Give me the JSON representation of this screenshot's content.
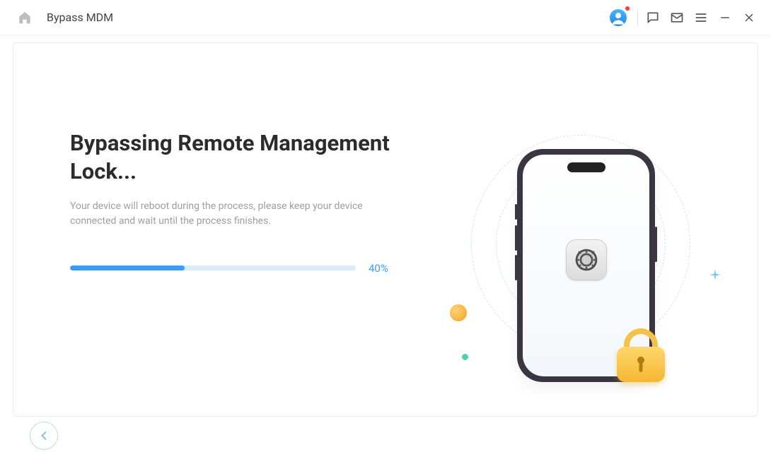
{
  "titlebar": {
    "title": "Bypass MDM"
  },
  "main": {
    "heading": "Bypassing Remote Management Lock...",
    "subtext": "Your device will reboot during the process, please keep your device connected and wait until the process finishes.",
    "progress": {
      "percent": 40,
      "label": "40%"
    }
  },
  "colors": {
    "accent": "#3a9cf2"
  }
}
